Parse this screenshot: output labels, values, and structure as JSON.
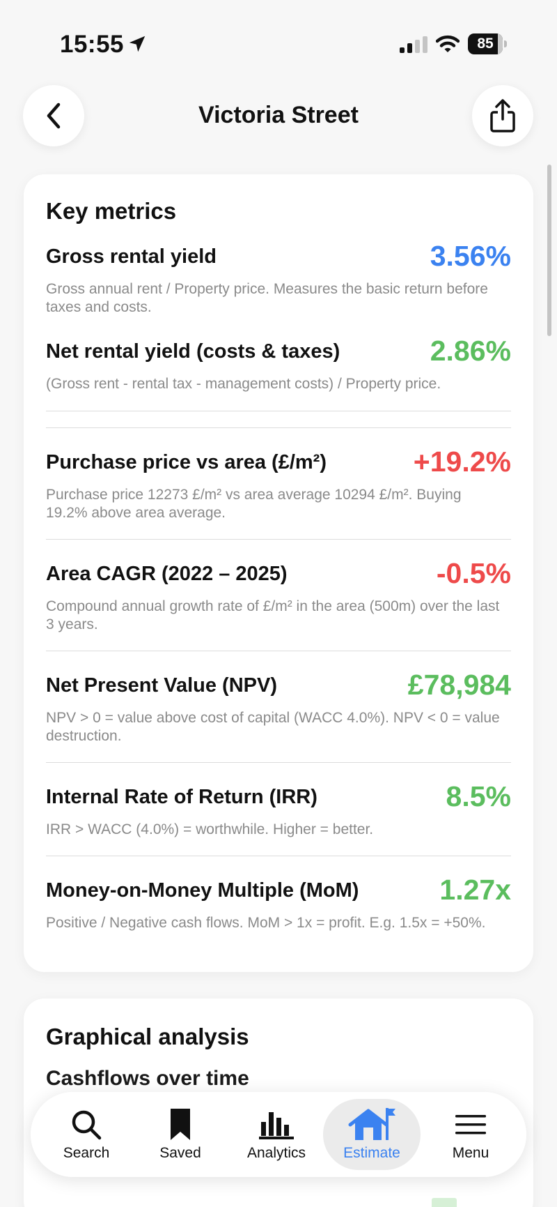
{
  "status_bar": {
    "time": "15:55",
    "battery": "85",
    "battery_level": 0.85
  },
  "header": {
    "title": "Victoria Street",
    "back_icon": "chevron-left-icon",
    "share_icon": "share-icon"
  },
  "key_metrics": {
    "title": "Key metrics",
    "items": [
      {
        "name": "Gross rental yield",
        "value": "3.56%",
        "color": "#3b82f0",
        "description": "Gross annual rent / Property price. Measures the basic return before taxes and costs."
      },
      {
        "name": "Net rental yield (costs & taxes)",
        "value": "2.86%",
        "color": "#5bbd5e",
        "description": "(Gross rent - rental tax - management costs) / Property price."
      },
      {
        "name": "Purchase price vs area (£/m²)",
        "value": "+19.2%",
        "color": "#ee4a4a",
        "description": "Purchase price 12273 £/m² vs area average 10294 £/m². Buying 19.2% above area average."
      },
      {
        "name": "Area CAGR (2022 – 2025)",
        "value": "-0.5%",
        "color": "#ee4a4a",
        "description": "Compound annual growth rate of £/m² in the area (500m) over the last 3 years."
      },
      {
        "name": "Net Present Value (NPV)",
        "value": "£78,984",
        "color": "#5bbd5e",
        "description": "NPV > 0 = value above cost of capital (WACC 4.0%). NPV < 0 = value destruction."
      },
      {
        "name": "Internal Rate of Return (IRR)",
        "value": "8.5%",
        "color": "#5bbd5e",
        "description": "IRR > WACC (4.0%) = worthwhile. Higher = better."
      },
      {
        "name": "Money-on-Money Multiple (MoM)",
        "value": "1.27x",
        "color": "#5bbd5e",
        "description": "Positive / Negative cash flows. MoM > 1x = profit. E.g. 1.5x = +50%."
      }
    ]
  },
  "graphical_analysis": {
    "title": "Graphical analysis",
    "subtitle": "Cashflows over time"
  },
  "tab_bar": {
    "tabs": [
      {
        "label": "Search",
        "icon": "search-icon",
        "active": false
      },
      {
        "label": "Saved",
        "icon": "bookmark-icon",
        "active": false
      },
      {
        "label": "Analytics",
        "icon": "bar-chart-icon",
        "active": false
      },
      {
        "label": "Estimate",
        "icon": "house-flag-icon",
        "active": true
      },
      {
        "label": "Menu",
        "icon": "menu-icon",
        "active": false
      }
    ]
  }
}
